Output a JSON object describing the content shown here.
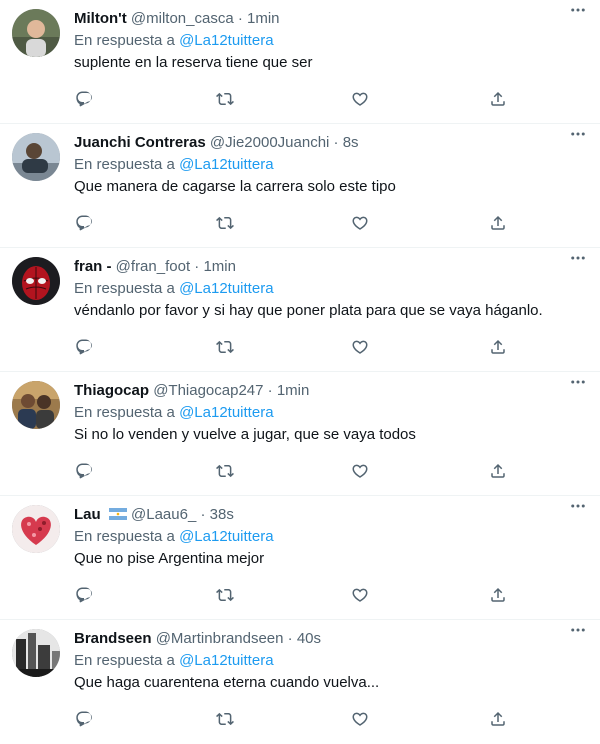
{
  "colors": {
    "accent": "#1d9bf0",
    "secondary_text": "#536471",
    "divider": "#eff3f4"
  },
  "icons": {
    "reply": "reply-icon",
    "retweet": "retweet-icon",
    "like": "heart-icon",
    "share": "share-icon",
    "more": "more-dots-icon"
  },
  "tweets": [
    {
      "name": "Milton't",
      "handle": "@milton_casca",
      "time": "1min",
      "reply_prefix": "En respuesta a",
      "reply_to": "@La12tuittera",
      "text": "suplente en la reserva tiene que ser"
    },
    {
      "name": "Juanchi Contreras",
      "handle": "@Jie2000Juanchi",
      "time": "8s",
      "reply_prefix": "En respuesta a",
      "reply_to": "@La12tuittera",
      "text": "Que manera de cagarse la carrera solo este tipo"
    },
    {
      "name": "fran -",
      "handle": "@fran_foot",
      "time": "1min",
      "reply_prefix": "En respuesta a",
      "reply_to": "@La12tuittera",
      "text": "véndanlo por favor y si hay que poner plata para que se vaya háganlo."
    },
    {
      "name": "Thiagocap",
      "handle": "@Thiagocap247",
      "time": "1min",
      "reply_prefix": "En respuesta a",
      "reply_to": "@La12tuittera",
      "text": "Si no lo venden y vuelve a jugar, que se vaya todos"
    },
    {
      "name": "Lau",
      "handle": "@Laau6_",
      "time": "38s",
      "reply_prefix": "En respuesta a",
      "reply_to": "@La12tuittera",
      "text": "Que no pise Argentina mejor"
    },
    {
      "name": "Brandseen",
      "handle": "@Martinbrandseen",
      "time": "40s",
      "reply_prefix": "En respuesta a",
      "reply_to": "@La12tuittera",
      "text": "Que haga cuarentena eterna cuando vuelva..."
    }
  ]
}
